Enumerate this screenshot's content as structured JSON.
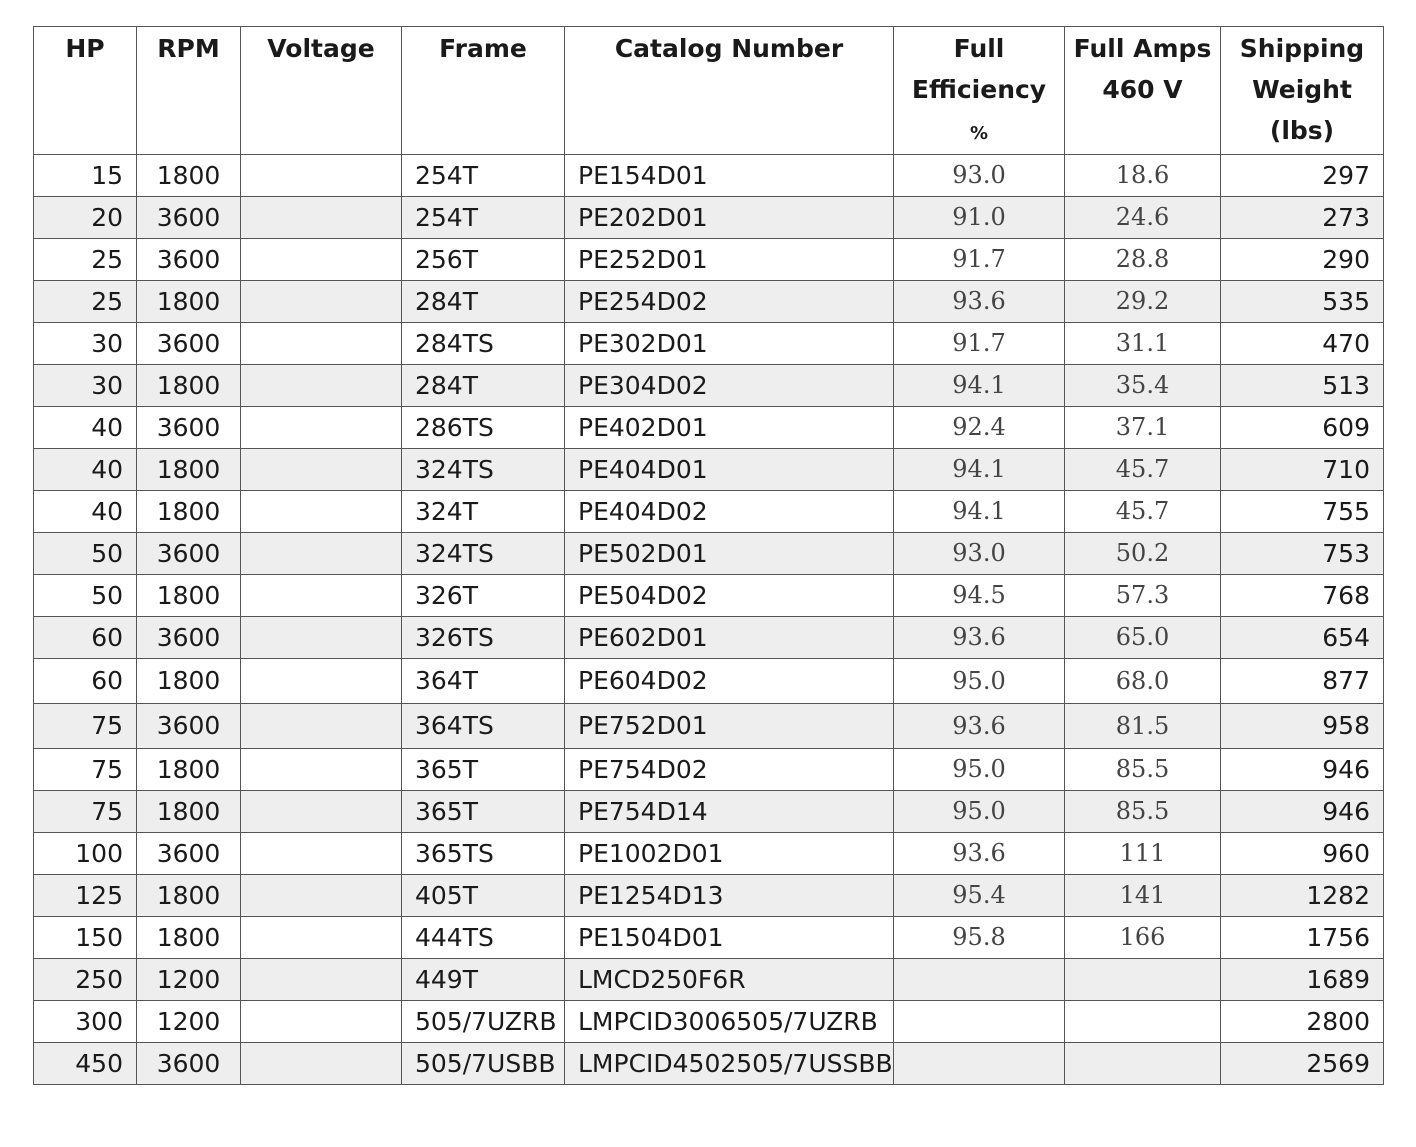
{
  "header": {
    "hp": "HP",
    "rpm": "RPM",
    "voltage": "Voltage",
    "frame": "Frame",
    "catalog": "Catalog Number",
    "efficiency_line1": "Full",
    "efficiency_line2": "Efficiency",
    "efficiency_unit": "%",
    "amps_line1": "Full Amps",
    "amps_line2": "460 V",
    "weight_line1": "Shipping",
    "weight_line2": "Weight",
    "weight_line3": "(lbs)"
  },
  "rows": [
    {
      "hp": "15",
      "rpm": "1800",
      "voltage": "",
      "frame": "254T",
      "catalog": "PE154D01",
      "efficiency": "93.0",
      "amps": "18.6",
      "weight": "297"
    },
    {
      "hp": "20",
      "rpm": "3600",
      "voltage": "",
      "frame": "254T",
      "catalog": "PE202D01",
      "efficiency": "91.0",
      "amps": "24.6",
      "weight": "273"
    },
    {
      "hp": "25",
      "rpm": "3600",
      "voltage": "",
      "frame": "256T",
      "catalog": "PE252D01",
      "efficiency": "91.7",
      "amps": "28.8",
      "weight": "290"
    },
    {
      "hp": "25",
      "rpm": "1800",
      "voltage": "",
      "frame": "284T",
      "catalog": "PE254D02",
      "efficiency": "93.6",
      "amps": "29.2",
      "weight": "535"
    },
    {
      "hp": "30",
      "rpm": "3600",
      "voltage": "",
      "frame": "284TS",
      "catalog": "PE302D01",
      "efficiency": "91.7",
      "amps": "31.1",
      "weight": "470"
    },
    {
      "hp": "30",
      "rpm": "1800",
      "voltage": "",
      "frame": "284T",
      "catalog": "PE304D02",
      "efficiency": "94.1",
      "amps": "35.4",
      "weight": "513"
    },
    {
      "hp": "40",
      "rpm": "3600",
      "voltage": "",
      "frame": "286TS",
      "catalog": "PE402D01",
      "efficiency": "92.4",
      "amps": "37.1",
      "weight": "609"
    },
    {
      "hp": "40",
      "rpm": "1800",
      "voltage": "",
      "frame": "324TS",
      "catalog": "PE404D01",
      "efficiency": "94.1",
      "amps": "45.7",
      "weight": "710"
    },
    {
      "hp": "40",
      "rpm": "1800",
      "voltage": "",
      "frame": "324T",
      "catalog": "PE404D02",
      "efficiency": "94.1",
      "amps": "45.7",
      "weight": "755"
    },
    {
      "hp": "50",
      "rpm": "3600",
      "voltage": "",
      "frame": "324TS",
      "catalog": "PE502D01",
      "efficiency": "93.0",
      "amps": "50.2",
      "weight": "753"
    },
    {
      "hp": "50",
      "rpm": "1800",
      "voltage": "",
      "frame": "326T",
      "catalog": "PE504D02",
      "efficiency": "94.5",
      "amps": "57.3",
      "weight": "768"
    },
    {
      "hp": "60",
      "rpm": "3600",
      "voltage": "",
      "frame": "326TS",
      "catalog": "PE602D01",
      "efficiency": "93.6",
      "amps": "65.0",
      "weight": "654"
    },
    {
      "hp": "60",
      "rpm": "1800",
      "voltage": "",
      "frame": "364T",
      "catalog": "PE604D02",
      "efficiency": "95.0",
      "amps": "68.0",
      "weight": "877"
    },
    {
      "hp": "75",
      "rpm": "3600",
      "voltage": "",
      "frame": "364TS",
      "catalog": "PE752D01",
      "efficiency": "93.6",
      "amps": "81.5",
      "weight": "958"
    },
    {
      "hp": "75",
      "rpm": "1800",
      "voltage": "",
      "frame": "365T",
      "catalog": "PE754D02",
      "efficiency": "95.0",
      "amps": "85.5",
      "weight": "946"
    },
    {
      "hp": "75",
      "rpm": "1800",
      "voltage": "",
      "frame": "365T",
      "catalog": "PE754D14",
      "efficiency": "95.0",
      "amps": "85.5",
      "weight": "946"
    },
    {
      "hp": "100",
      "rpm": "3600",
      "voltage": "",
      "frame": "365TS",
      "catalog": "PE1002D01",
      "efficiency": "93.6",
      "amps": "111",
      "weight": "960"
    },
    {
      "hp": "125",
      "rpm": "1800",
      "voltage": "",
      "frame": "405T",
      "catalog": "PE1254D13",
      "efficiency": "95.4",
      "amps": "141",
      "weight": "1282"
    },
    {
      "hp": "150",
      "rpm": "1800",
      "voltage": "",
      "frame": "444TS",
      "catalog": "PE1504D01",
      "efficiency": "95.8",
      "amps": "166",
      "weight": "1756"
    },
    {
      "hp": "250",
      "rpm": "1200",
      "voltage": "",
      "frame": "449T",
      "catalog": "LMCD250F6R",
      "efficiency": "",
      "amps": "",
      "weight": "1689"
    },
    {
      "hp": "300",
      "rpm": "1200",
      "voltage": "",
      "frame": "505/7UZRB",
      "catalog": "LMPCID3006505/7UZRB",
      "efficiency": "",
      "amps": "",
      "weight": "2800"
    },
    {
      "hp": "450",
      "rpm": "3600",
      "voltage": "",
      "frame": "505/7USBB",
      "catalog": "LMPCID4502505/7USSBB",
      "efficiency": "",
      "amps": "",
      "weight": "2569"
    }
  ]
}
